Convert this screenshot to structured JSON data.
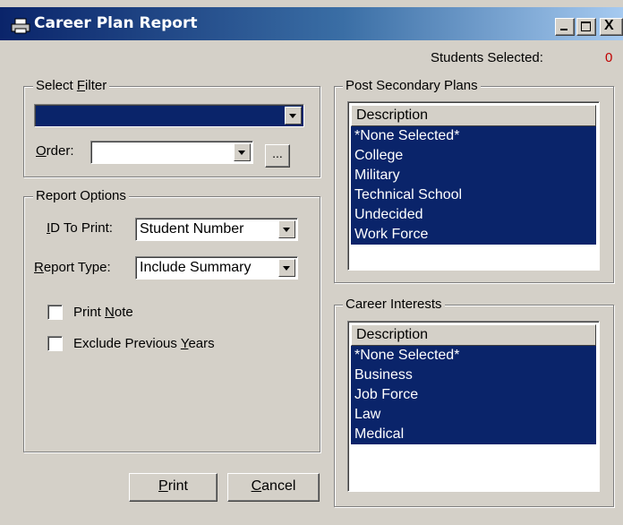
{
  "window": {
    "title": "Career Plan Report",
    "minimize": "_",
    "maximize": "□",
    "close": "X"
  },
  "students_selected": {
    "label": "Students Selected:",
    "count": "0"
  },
  "select_filter": {
    "group_label_pre": "Select ",
    "group_label_u": "F",
    "group_label_post": "ilter",
    "filter_value": "",
    "order_label_u": "O",
    "order_label_post": "rder:",
    "order_value": "",
    "ellipsis": "..."
  },
  "report_options": {
    "group_label": "Report Options",
    "id_label_u": "I",
    "id_label_post": "D To Print:",
    "id_value": "Student Number",
    "type_label_u": "R",
    "type_label_post": "eport Type:",
    "type_value": "Include Summary",
    "print_note_pre": "Print ",
    "print_note_u": "N",
    "print_note_post": "ote",
    "exclude_pre": "Exclude Previous ",
    "exclude_u": "Y",
    "exclude_post": "ears"
  },
  "buttons": {
    "print_u": "P",
    "print_post": "rint",
    "cancel_u": "C",
    "cancel_post": "ancel"
  },
  "post_secondary": {
    "group_label": "Post Secondary Plans",
    "header": "Description",
    "items": [
      "*None Selected*",
      "College",
      "Military",
      "Technical School",
      "Undecided",
      "Work Force"
    ]
  },
  "career_interests": {
    "group_label": "Career Interests",
    "header": "Description",
    "items": [
      "*None Selected*",
      "Business",
      "Job Force",
      "Law",
      "Medical"
    ]
  }
}
